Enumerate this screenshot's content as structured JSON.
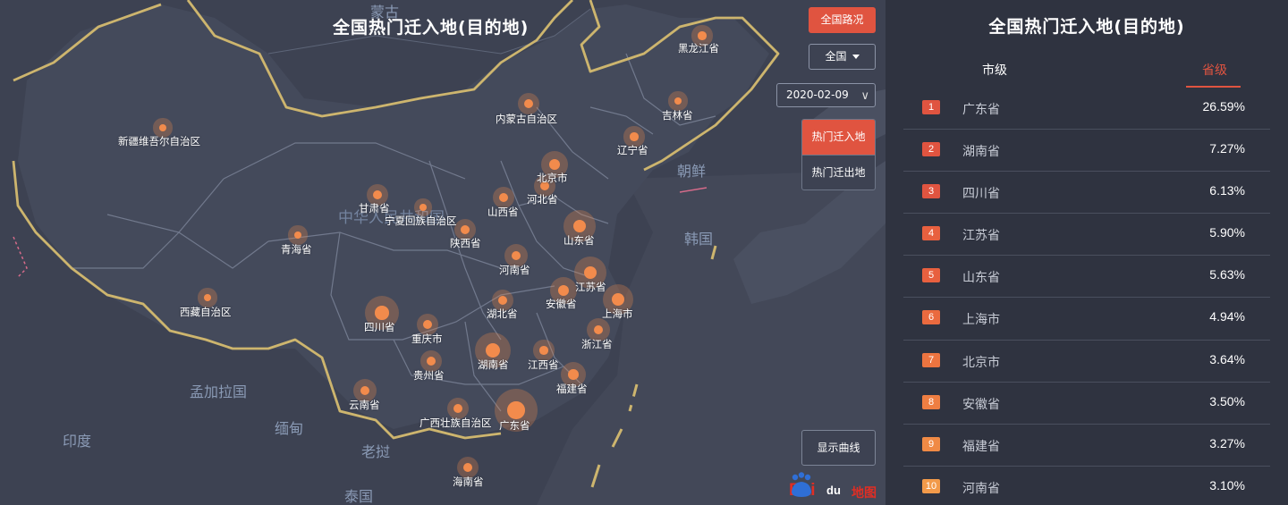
{
  "map": {
    "title": "全国热门迁入地(目的地)",
    "countries": [
      {
        "key": "mongolia",
        "label": "蒙古"
      },
      {
        "key": "china",
        "label": "中华人民共和国"
      },
      {
        "key": "korea_north",
        "label": "朝鲜"
      },
      {
        "key": "korea_south",
        "label": "韩国"
      },
      {
        "key": "bangladesh",
        "label": "孟加拉国"
      },
      {
        "key": "myanmar",
        "label": "缅甸"
      },
      {
        "key": "india",
        "label": "印度"
      },
      {
        "key": "laos",
        "label": "老挝"
      },
      {
        "key": "thailand",
        "label": "泰国"
      }
    ],
    "provinces": [
      {
        "label": "黑龙江省",
        "weight": 0.35
      },
      {
        "label": "吉林省",
        "weight": 0.3
      },
      {
        "label": "辽宁省",
        "weight": 0.35
      },
      {
        "label": "内蒙古自治区",
        "weight": 0.4
      },
      {
        "label": "新疆维吾尔自治区",
        "weight": 0.3
      },
      {
        "label": "北京市",
        "weight": 0.55
      },
      {
        "label": "河北省",
        "weight": 0.4
      },
      {
        "label": "山西省",
        "weight": 0.4
      },
      {
        "label": "甘肃省",
        "weight": 0.4
      },
      {
        "label": "宁夏回族自治区",
        "weight": 0.25
      },
      {
        "label": "陕西省",
        "weight": 0.4
      },
      {
        "label": "山东省",
        "weight": 0.7
      },
      {
        "label": "青海省",
        "weight": 0.3
      },
      {
        "label": "河南省",
        "weight": 0.45
      },
      {
        "label": "江苏省",
        "weight": 0.7
      },
      {
        "label": "西藏自治区",
        "weight": 0.3
      },
      {
        "label": "湖北省",
        "weight": 0.4
      },
      {
        "label": "安徽省",
        "weight": 0.55
      },
      {
        "label": "上海市",
        "weight": 0.65
      },
      {
        "label": "四川省",
        "weight": 0.75
      },
      {
        "label": "重庆市",
        "weight": 0.4
      },
      {
        "label": "浙江省",
        "weight": 0.45
      },
      {
        "label": "湖南省",
        "weight": 0.8
      },
      {
        "label": "江西省",
        "weight": 0.35
      },
      {
        "label": "贵州省",
        "weight": 0.4
      },
      {
        "label": "福建省",
        "weight": 0.5
      },
      {
        "label": "云南省",
        "weight": 0.45
      },
      {
        "label": "广西壮族自治区",
        "weight": 0.4
      },
      {
        "label": "广东省",
        "weight": 1.0
      },
      {
        "label": "海南省",
        "weight": 0.4
      }
    ]
  },
  "controls": {
    "route_button": "全国路况",
    "region_select": "全国",
    "date_select": "2020-02-09",
    "toggle_in": "热门迁入地",
    "toggle_out": "热门迁出地",
    "curve_button": "显示曲线"
  },
  "logo": {
    "text_bai": "Bai",
    "text_du": "du",
    "text_ditu": "地图"
  },
  "panel": {
    "title": "全国热门迁入地(目的地)",
    "tab_city": "市级",
    "tab_province": "省级",
    "rows": [
      {
        "rank": "1",
        "name": "广东省",
        "value": "26.59%",
        "color": "#e05440"
      },
      {
        "rank": "2",
        "name": "湖南省",
        "value": "7.27%",
        "color": "#e05440"
      },
      {
        "rank": "3",
        "name": "四川省",
        "value": "6.13%",
        "color": "#e05440"
      },
      {
        "rank": "4",
        "name": "江苏省",
        "value": "5.90%",
        "color": "#e8603f"
      },
      {
        "rank": "5",
        "name": "山东省",
        "value": "5.63%",
        "color": "#e8603f"
      },
      {
        "rank": "6",
        "name": "上海市",
        "value": "4.94%",
        "color": "#ea6a3f"
      },
      {
        "rank": "7",
        "name": "北京市",
        "value": "3.64%",
        "color": "#ec7440"
      },
      {
        "rank": "8",
        "name": "安徽省",
        "value": "3.50%",
        "color": "#ee7e42"
      },
      {
        "rank": "9",
        "name": "福建省",
        "value": "3.27%",
        "color": "#f08a45"
      },
      {
        "rank": "10",
        "name": "河南省",
        "value": "3.10%",
        "color": "#f29a4a"
      }
    ]
  }
}
